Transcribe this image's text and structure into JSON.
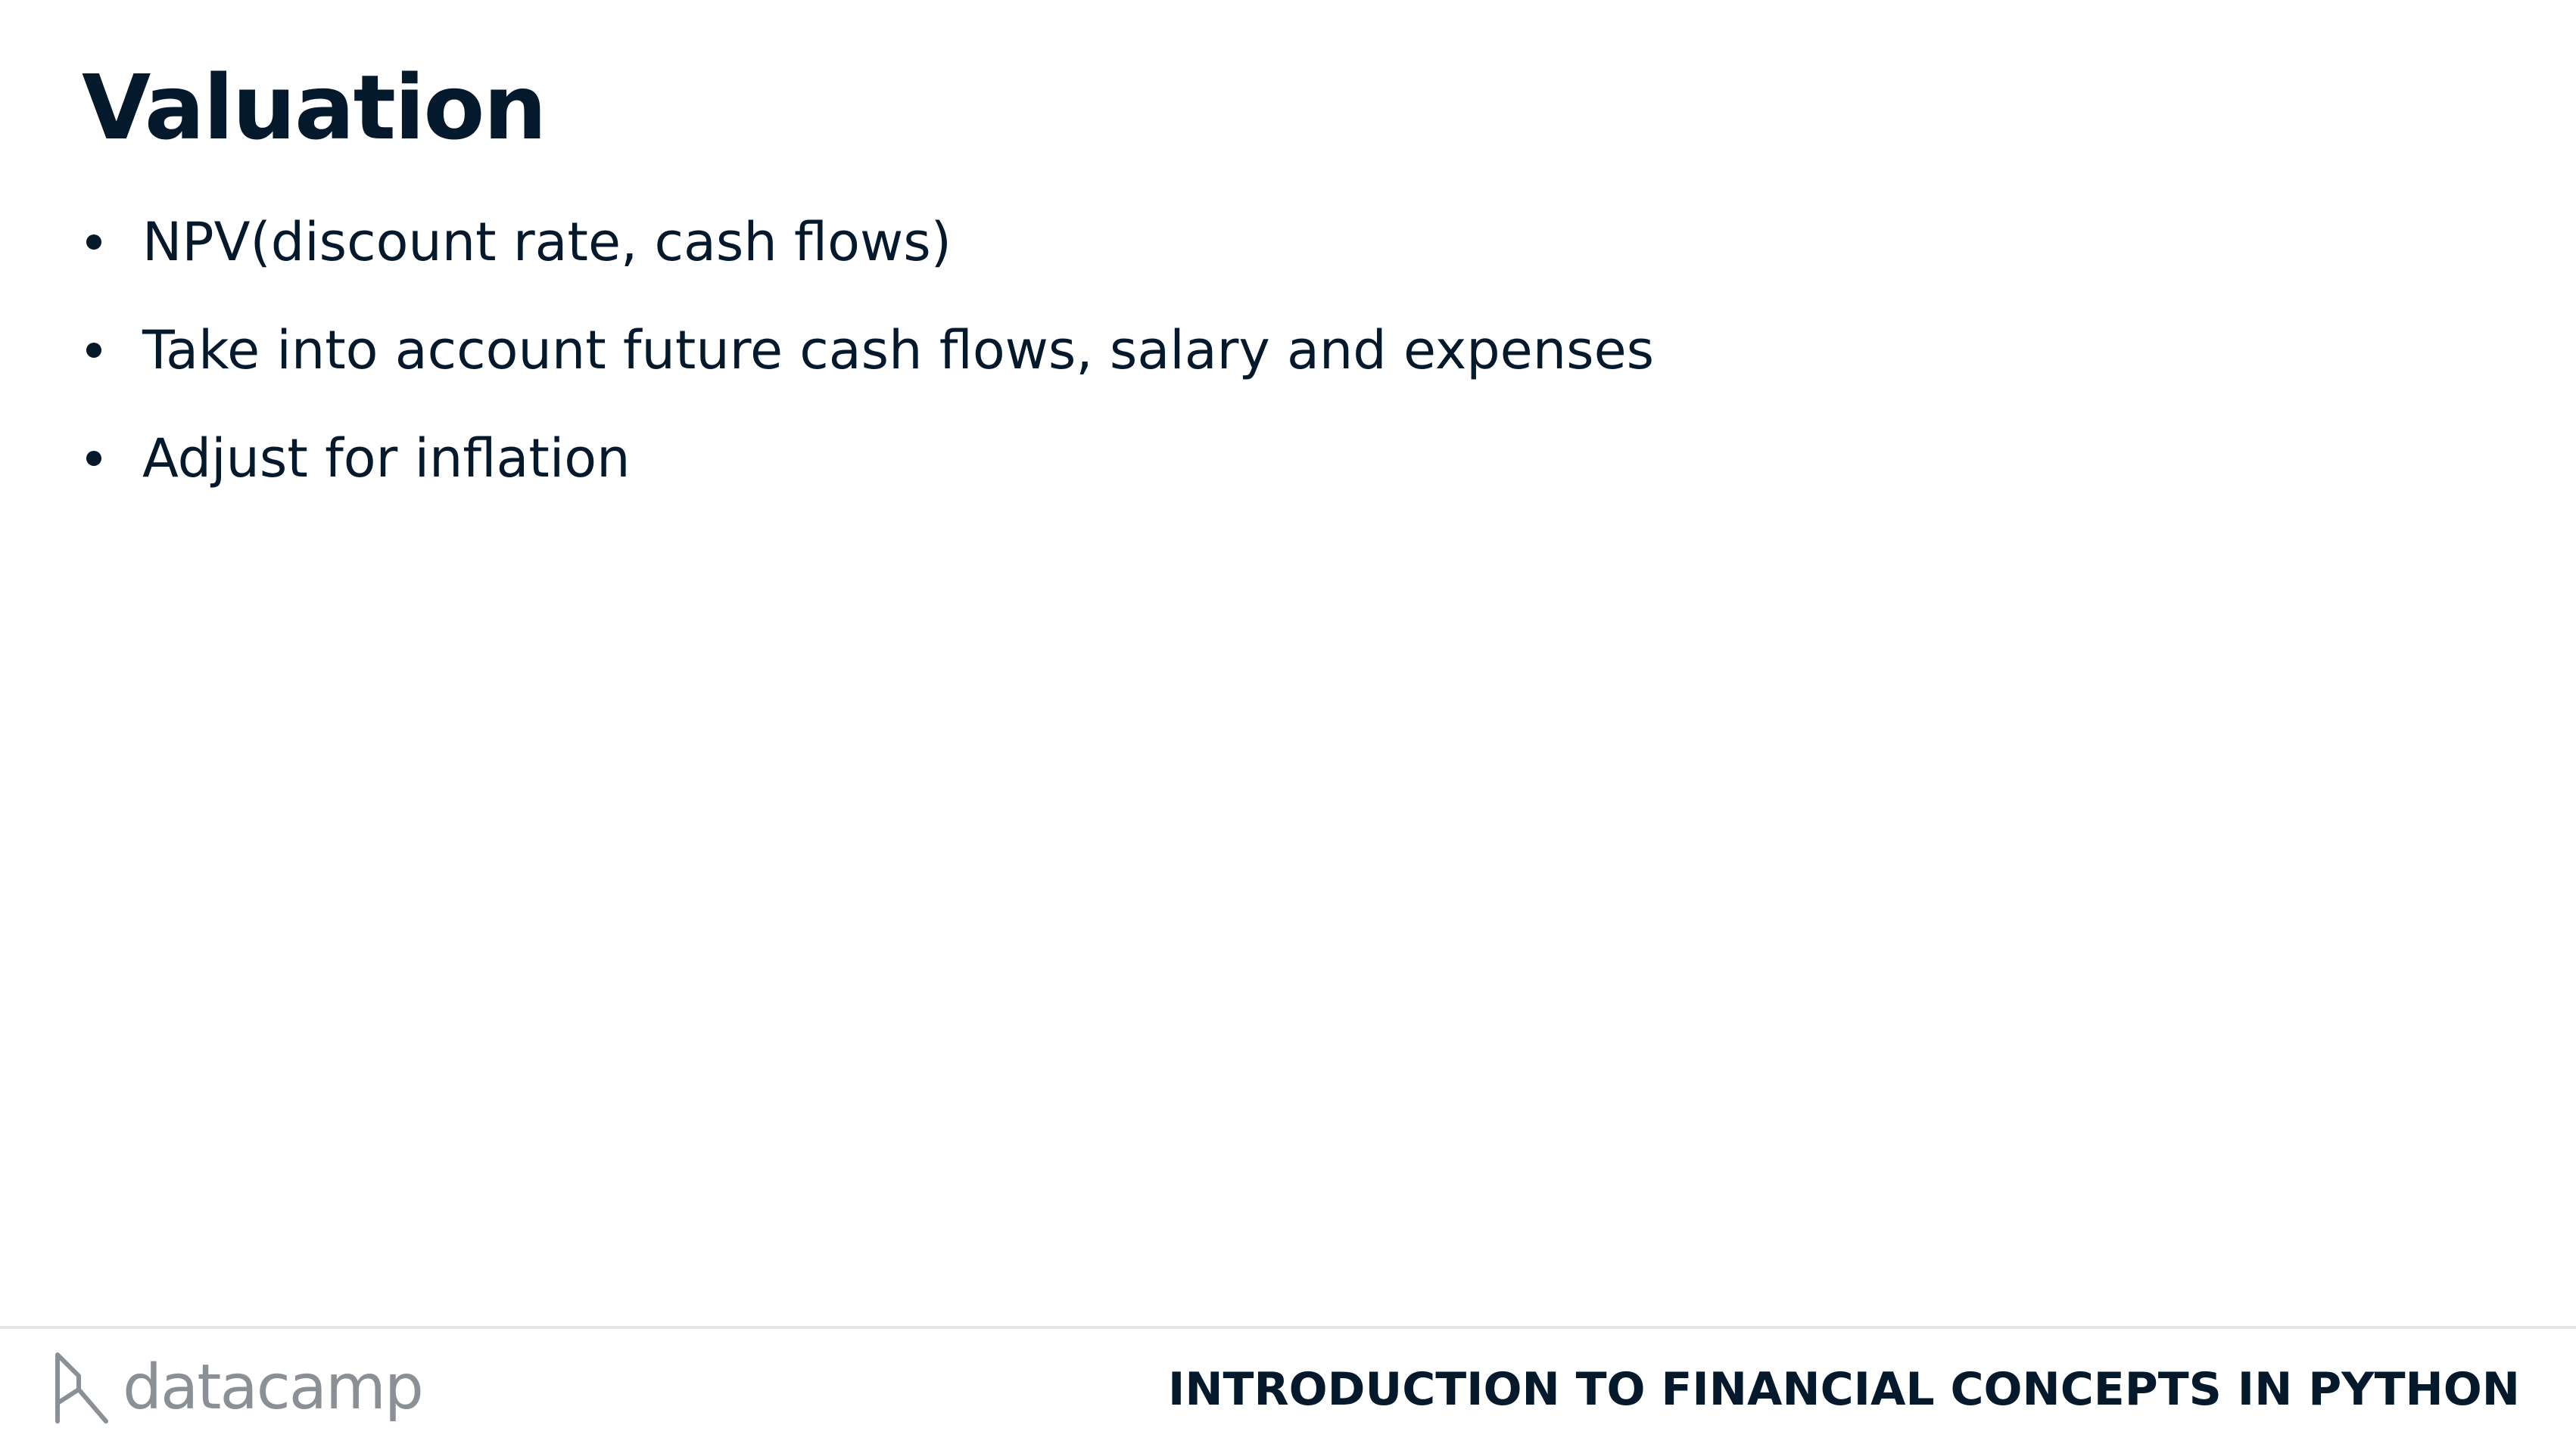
{
  "slide": {
    "title": "Valuation",
    "bullets": [
      {
        "text": "NPV(discount rate, cash flows)"
      },
      {
        "text": "Take into account future cash flows, salary and expenses"
      },
      {
        "text": "Adjust for inflation"
      }
    ]
  },
  "footer": {
    "logo_text": "datacamp",
    "logo_icon": "datacamp-logo-icon",
    "course_title": "INTRODUCTION TO FINANCIAL CONCEPTS IN PYTHON"
  },
  "colors": {
    "text": "#05192d",
    "logo": "#8a9096",
    "divider": "#e6e6e6",
    "background": "#ffffff"
  }
}
